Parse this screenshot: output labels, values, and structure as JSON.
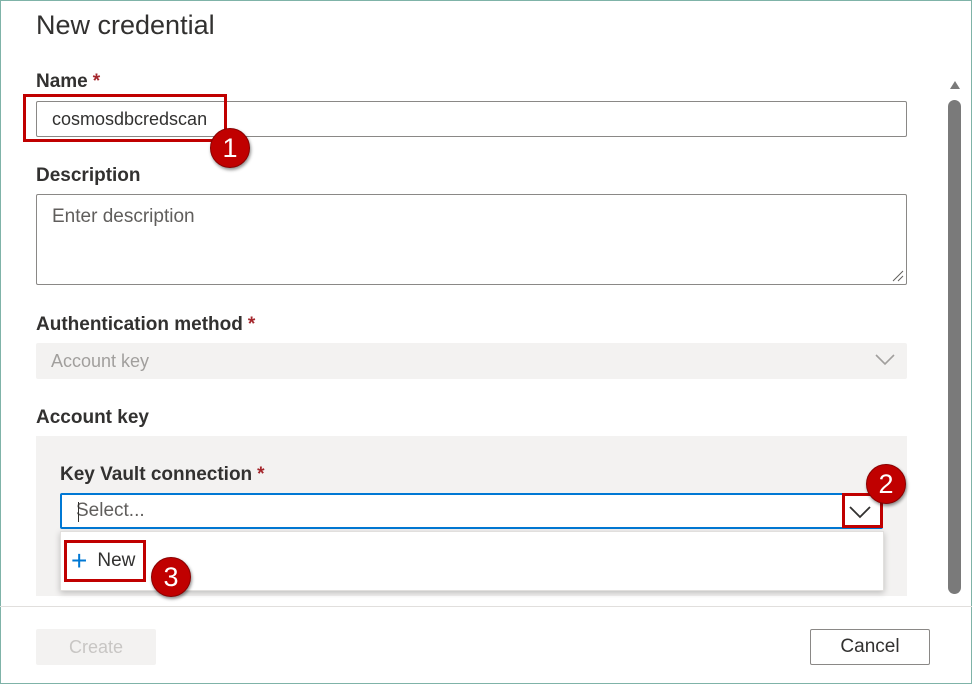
{
  "panel": {
    "title": "New credential"
  },
  "form": {
    "name": {
      "label": "Name",
      "required_mark": "*",
      "value": "cosmosdbcredscan"
    },
    "description": {
      "label": "Description",
      "placeholder": "Enter description"
    },
    "auth_method": {
      "label": "Authentication method",
      "required_mark": "*",
      "value": "Account key",
      "disabled": true
    },
    "account_key": {
      "section_label": "Account key"
    },
    "key_vault": {
      "label": "Key Vault connection",
      "required_mark": "*",
      "placeholder": "Select...",
      "options": [
        {
          "icon": "plus-icon",
          "label": "New"
        }
      ]
    }
  },
  "annotations": {
    "badge_1": "1",
    "badge_2": "2",
    "badge_3": "3",
    "color": "#c00000"
  },
  "footer": {
    "create_label": "Create",
    "cancel_label": "Cancel"
  },
  "colors": {
    "accent": "#0078d4",
    "required": "#a4262c",
    "disabled_bg": "#f3f2f1"
  }
}
